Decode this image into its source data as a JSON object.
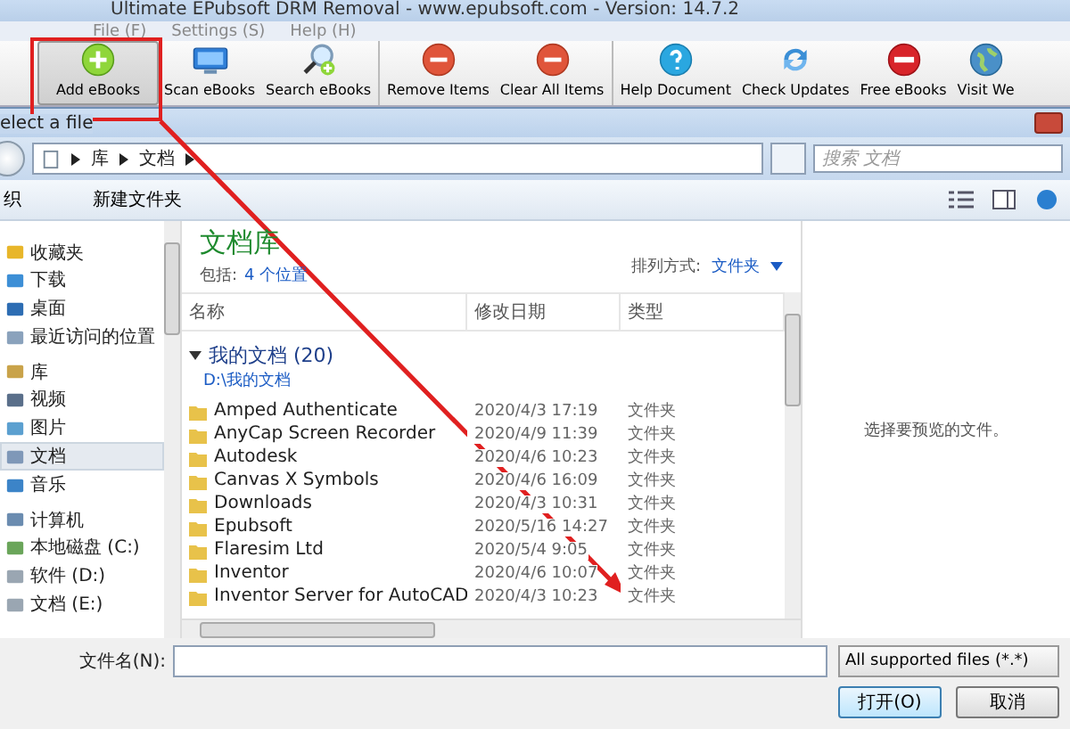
{
  "window": {
    "title": "Ultimate EPubsoft DRM Removal - www.epubsoft.com - Version: 14.7.2"
  },
  "menu": [
    "File (F)",
    "Settings (S)",
    "Help (H)"
  ],
  "toolbar": [
    [
      {
        "label": "Add eBooks",
        "kind": "add",
        "pressed": true
      },
      {
        "label": "Scan eBooks",
        "kind": "scan",
        "pressed": false
      },
      {
        "label": "Search eBooks",
        "kind": "search",
        "pressed": false
      }
    ],
    [
      {
        "label": "Remove Items",
        "kind": "remove",
        "pressed": false
      },
      {
        "label": "Clear All Items",
        "kind": "remove",
        "pressed": false
      }
    ],
    [
      {
        "label": "Help Document",
        "kind": "help",
        "pressed": false
      },
      {
        "label": "Check Updates",
        "kind": "update",
        "pressed": false
      },
      {
        "label": "Free eBooks",
        "kind": "free",
        "pressed": false
      },
      {
        "label": "Visit We",
        "kind": "globe",
        "pressed": false
      }
    ]
  ],
  "dialog": {
    "title": "elect a file",
    "path": [
      "库",
      "文档"
    ],
    "search": {
      "placeholder": "搜索 文档"
    },
    "commands": [
      "织",
      "新建文件夹"
    ],
    "nav": [
      {
        "label": "收藏夹",
        "kind": "star",
        "selected": false,
        "children": [
          {
            "label": "下载",
            "kind": "download",
            "selected": false
          },
          {
            "label": "桌面",
            "kind": "desktop",
            "selected": false
          },
          {
            "label": "最近访问的位置",
            "kind": "recent",
            "selected": false
          }
        ]
      },
      {
        "label": "库",
        "kind": "library",
        "selected": false,
        "children": [
          {
            "label": "视频",
            "kind": "video",
            "selected": false
          },
          {
            "label": "图片",
            "kind": "picture",
            "selected": false
          },
          {
            "label": "文档",
            "kind": "doc",
            "selected": true
          },
          {
            "label": "音乐",
            "kind": "music",
            "selected": false
          }
        ]
      },
      {
        "label": "计算机",
        "kind": "computer",
        "selected": false,
        "children": [
          {
            "label": "本地磁盘 (C:)",
            "kind": "system-drive",
            "selected": false
          },
          {
            "label": "软件 (D:)",
            "kind": "drive",
            "selected": false
          },
          {
            "label": "文档 (E:)",
            "kind": "drive",
            "selected": false
          }
        ]
      }
    ],
    "library_title": "文档库",
    "includes_label": "包括:",
    "includes_link": "4 个位置",
    "arrange_label": "排列方式:",
    "arrange_value": "文件夹",
    "columns": [
      "名称",
      "修改日期",
      "类型"
    ],
    "group": {
      "title": "我的文档 (20)",
      "path": "D:\\我的文档"
    },
    "rows": [
      {
        "name": "Amped Authenticate",
        "date": "2020/4/3 17:19",
        "type": "文件夹"
      },
      {
        "name": "AnyCap Screen Recorder",
        "date": "2020/4/9 11:39",
        "type": "文件夹"
      },
      {
        "name": "Autodesk",
        "date": "2020/4/6 10:23",
        "type": "文件夹"
      },
      {
        "name": "Canvas X Symbols",
        "date": "2020/4/6 16:09",
        "type": "文件夹"
      },
      {
        "name": "Downloads",
        "date": "2020/4/3 10:31",
        "type": "文件夹"
      },
      {
        "name": "Epubsoft",
        "date": "2020/5/16 14:27",
        "type": "文件夹"
      },
      {
        "name": "Flaresim Ltd",
        "date": "2020/5/4 9:05",
        "type": "文件夹"
      },
      {
        "name": "Inventor",
        "date": "2020/4/6 10:07",
        "type": "文件夹"
      },
      {
        "name": "Inventor Server for AutoCAD",
        "date": "2020/4/3 10:23",
        "type": "文件夹"
      }
    ],
    "preview_message": "选择要预览的文件。",
    "filename_label": "文件名(N):",
    "filter": "All supported files (*.*)",
    "buttons": [
      "打开(O)",
      "取消"
    ]
  }
}
